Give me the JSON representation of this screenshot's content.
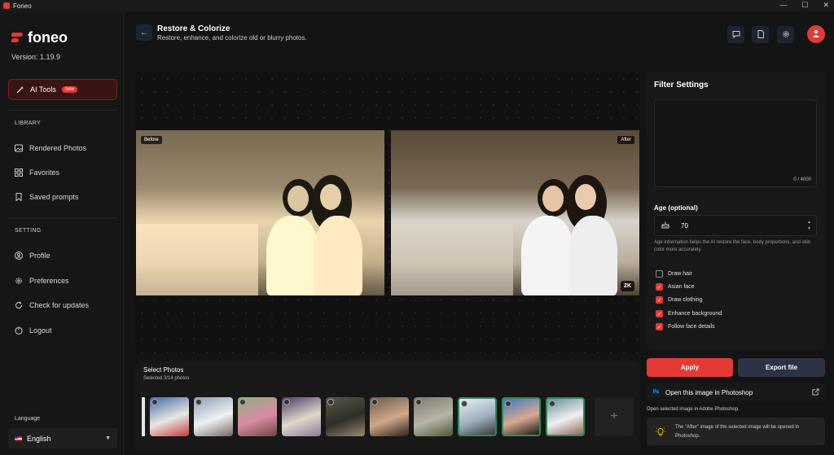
{
  "window": {
    "title": "Foneo",
    "controls": [
      "—",
      "☐",
      "✕"
    ]
  },
  "sidebar": {
    "logo_text": "foneo",
    "version": "Version: 1.19.9",
    "active_item": {
      "label": "AI Tools",
      "badge": "new"
    },
    "library_label": "LIBRARY",
    "library_items": [
      {
        "label": "Rendered Photos",
        "icon": "image-icon"
      },
      {
        "label": "Favorites",
        "icon": "grid-icon"
      },
      {
        "label": "Saved prompts",
        "icon": "bookmark-icon"
      }
    ],
    "setting_label": "SETTING",
    "setting_items": [
      {
        "label": "Profile",
        "icon": "user-icon"
      },
      {
        "label": "Preferences",
        "icon": "gear-icon"
      },
      {
        "label": "Check for updates",
        "icon": "refresh-icon"
      },
      {
        "label": "Logout",
        "icon": "logout-icon"
      }
    ],
    "language_label": "Language",
    "language_value": "English"
  },
  "header": {
    "title": "Restore & Colorize",
    "subtitle": "Restore, enhance, and colorize old or blurry photos."
  },
  "preview": {
    "before_label": "Before",
    "after_label": "After",
    "resolution_badge": "2K"
  },
  "select_photos": {
    "title": "Select Photos",
    "subtitle": "Selected 3/14 photos",
    "add_label": "+",
    "thumbnails": [
      {
        "colors": [
          "#3f6aa8",
          "#e9e6e0",
          "#c23c3c"
        ],
        "selected": false
      },
      {
        "colors": [
          "#8aa0b8",
          "#f0f0f0",
          "#6f6a60"
        ],
        "selected": false
      },
      {
        "colors": [
          "#8fb07a",
          "#d98aa6",
          "#6b4a3a"
        ],
        "selected": false
      },
      {
        "colors": [
          "#4a3a6a",
          "#e0d8c8",
          "#8a7aa0"
        ],
        "selected": false
      },
      {
        "colors": [
          "#5a5a4a",
          "#2d2d2a",
          "#9a8a70"
        ],
        "selected": false
      },
      {
        "colors": [
          "#6a5a4a",
          "#d0a888",
          "#2a2220"
        ],
        "selected": false
      },
      {
        "colors": [
          "#7a7a6a",
          "#b8b4a6",
          "#4a5a3a"
        ],
        "selected": false
      },
      {
        "colors": [
          "#e8eef0",
          "#a0b0c0",
          "#3a3a3a"
        ],
        "selected": true
      },
      {
        "colors": [
          "#3a7ac0",
          "#d8a890",
          "#1a1a1a"
        ],
        "selected": true
      },
      {
        "colors": [
          "#6a8a9a",
          "#f0f0f0",
          "#8a6a5a"
        ],
        "selected": true
      }
    ]
  },
  "filter": {
    "title": "Filter Settings",
    "char_count": "0 / 4000",
    "age_label": "Age (optional)",
    "age_value": "70",
    "age_help": "Age information helps the AI restore the face, body proportions, and skin color more accurately.",
    "options": [
      {
        "label": "Draw hair",
        "checked": false
      },
      {
        "label": "Asian face",
        "checked": true
      },
      {
        "label": "Draw clothing",
        "checked": true
      },
      {
        "label": "Enhance background",
        "checked": true
      },
      {
        "label": "Follow face details",
        "checked": true
      }
    ]
  },
  "actions": {
    "apply_label": "Apply",
    "export_label": "Export file",
    "photoshop_label": "Open this image in Photoshop",
    "photoshop_logo": "Ps",
    "photoshop_note": "Open selected image in Adobe Photoshop.",
    "photoshop_info": "The \"After\" image of the selected image will be opened in Photoshop."
  },
  "colors": {
    "accent": "#e53935",
    "panel": "#181818",
    "background": "#141414",
    "selected_thumb": "#2e8b57"
  }
}
